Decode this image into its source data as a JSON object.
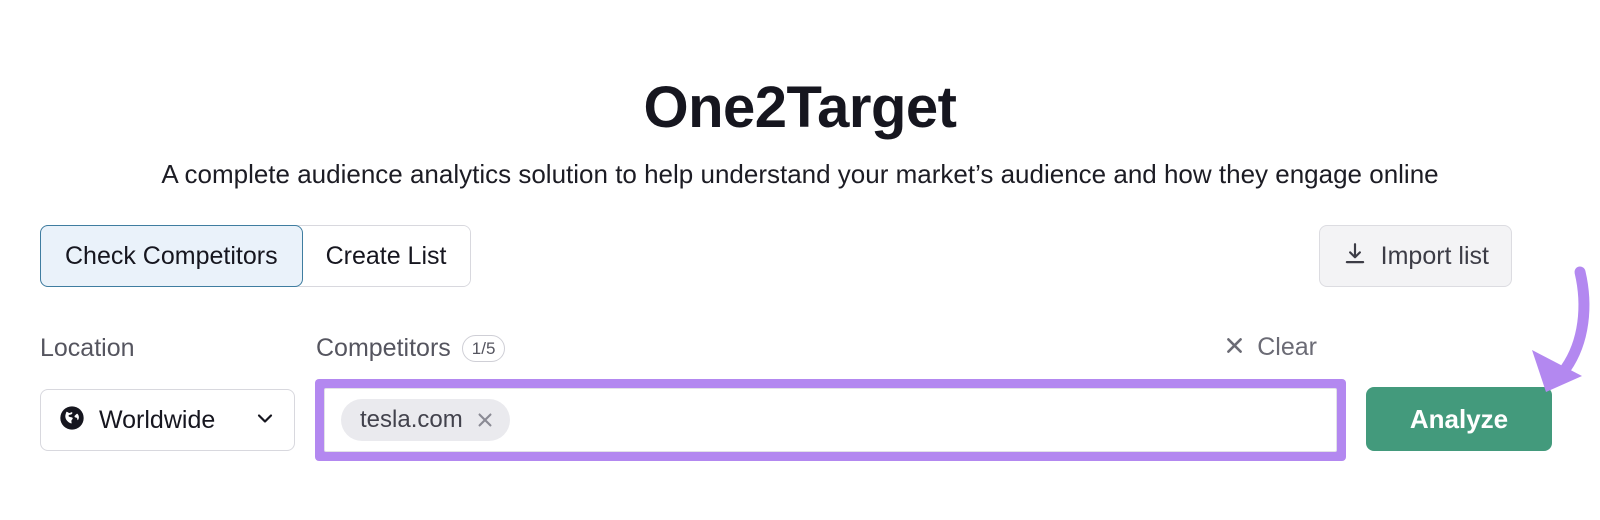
{
  "header": {
    "title": "One2Target",
    "subtitle": "A complete audience analytics solution to help understand your market’s audience and how they engage online"
  },
  "tabs": [
    {
      "label": "Check Competitors",
      "active": true
    },
    {
      "label": "Create List",
      "active": false
    }
  ],
  "toolbar": {
    "import_label": "Import list",
    "import_icon": "download-icon"
  },
  "fields": {
    "location": {
      "label": "Location",
      "value": "Worldwide",
      "icon": "globe-icon",
      "chevron_icon": "chevron-down-icon"
    },
    "competitors": {
      "label": "Competitors",
      "count_badge": "1/5",
      "clear_label": "Clear",
      "clear_icon": "close-x-icon",
      "placeholder": "",
      "input_value": "",
      "chips": [
        {
          "label": "tesla.com",
          "remove_icon": "close-x-icon"
        }
      ]
    }
  },
  "actions": {
    "analyze_label": "Analyze"
  },
  "annotation": {
    "arrow_icon": "curved-arrow-icon",
    "arrow_color": "#b388f0",
    "points_to": "analyze-button"
  },
  "colors": {
    "accent_green": "#439a7c",
    "highlight_purple": "#b388f0",
    "active_tab_bg": "#eaf2fa",
    "active_tab_border": "#3f7da0",
    "title_text": "#16161f",
    "muted_text": "#55555f",
    "chip_bg": "#eaeaee",
    "page_bg": "#ffffff"
  }
}
